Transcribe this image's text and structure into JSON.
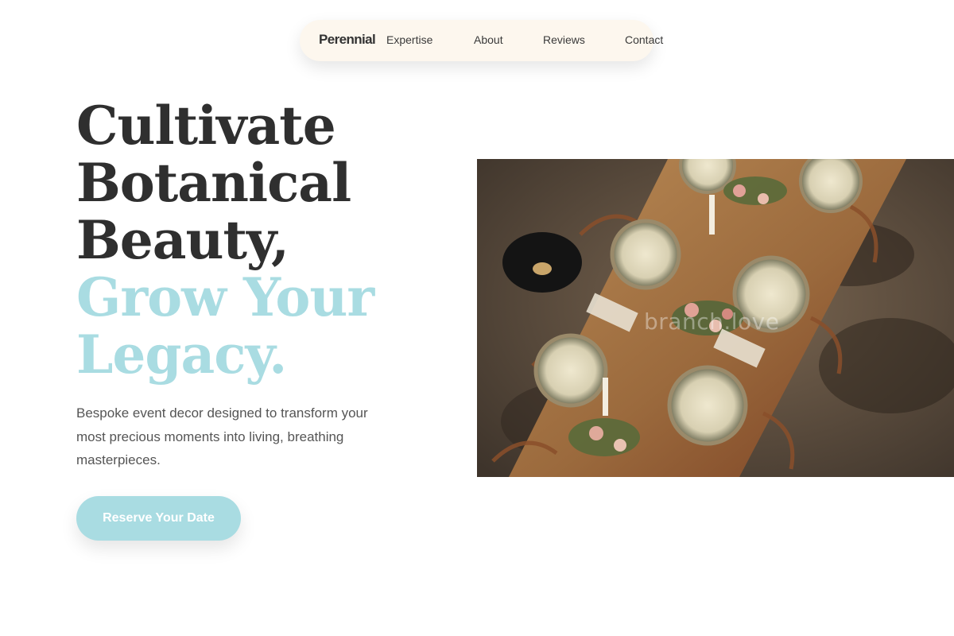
{
  "nav": {
    "brand": "Perennial",
    "links": [
      "Expertise",
      "About",
      "Reviews",
      "Contact"
    ]
  },
  "hero": {
    "headline_lines": [
      "Cultivate",
      "Botanical",
      "Beauty,"
    ],
    "headline_accent_lines": [
      "Grow Your",
      "Legacy."
    ],
    "subtitle": "Bespoke event decor designed to transform your most precious moments into living, breathing masterpieces.",
    "cta_label": "Reserve Your Date",
    "image_watermark": "branch.love"
  },
  "colors": {
    "accent": "#a9dce2",
    "nav_background": "#fdf7ee",
    "headline": "#2f2f2f",
    "body_text": "#555555"
  }
}
